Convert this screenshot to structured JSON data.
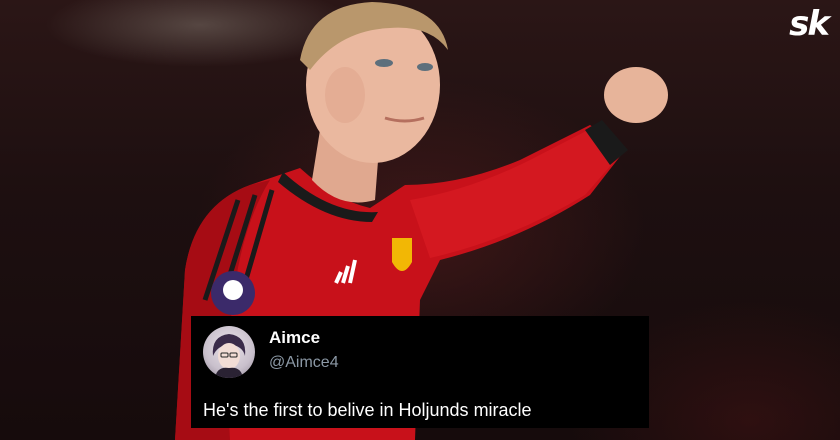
{
  "brand": {
    "logo_text": "sk",
    "logo_icon": "sportskeeda-logo"
  },
  "photo": {
    "subject_icon": "player-photo",
    "jersey_color": "#d9141a",
    "badges": [
      "premier-league-badge",
      "club-crest-badge",
      "three-stripes-logo"
    ]
  },
  "tweet": {
    "avatar_icon": "user-avatar",
    "name": "Aimce",
    "handle": "@Aimce4",
    "text": "He's the first to belive in Holjunds miracle"
  },
  "colors": {
    "card_background": "#000000",
    "name_text": "#ffffff",
    "handle_text": "#8b98a5",
    "jersey_red": "#d9141a"
  }
}
